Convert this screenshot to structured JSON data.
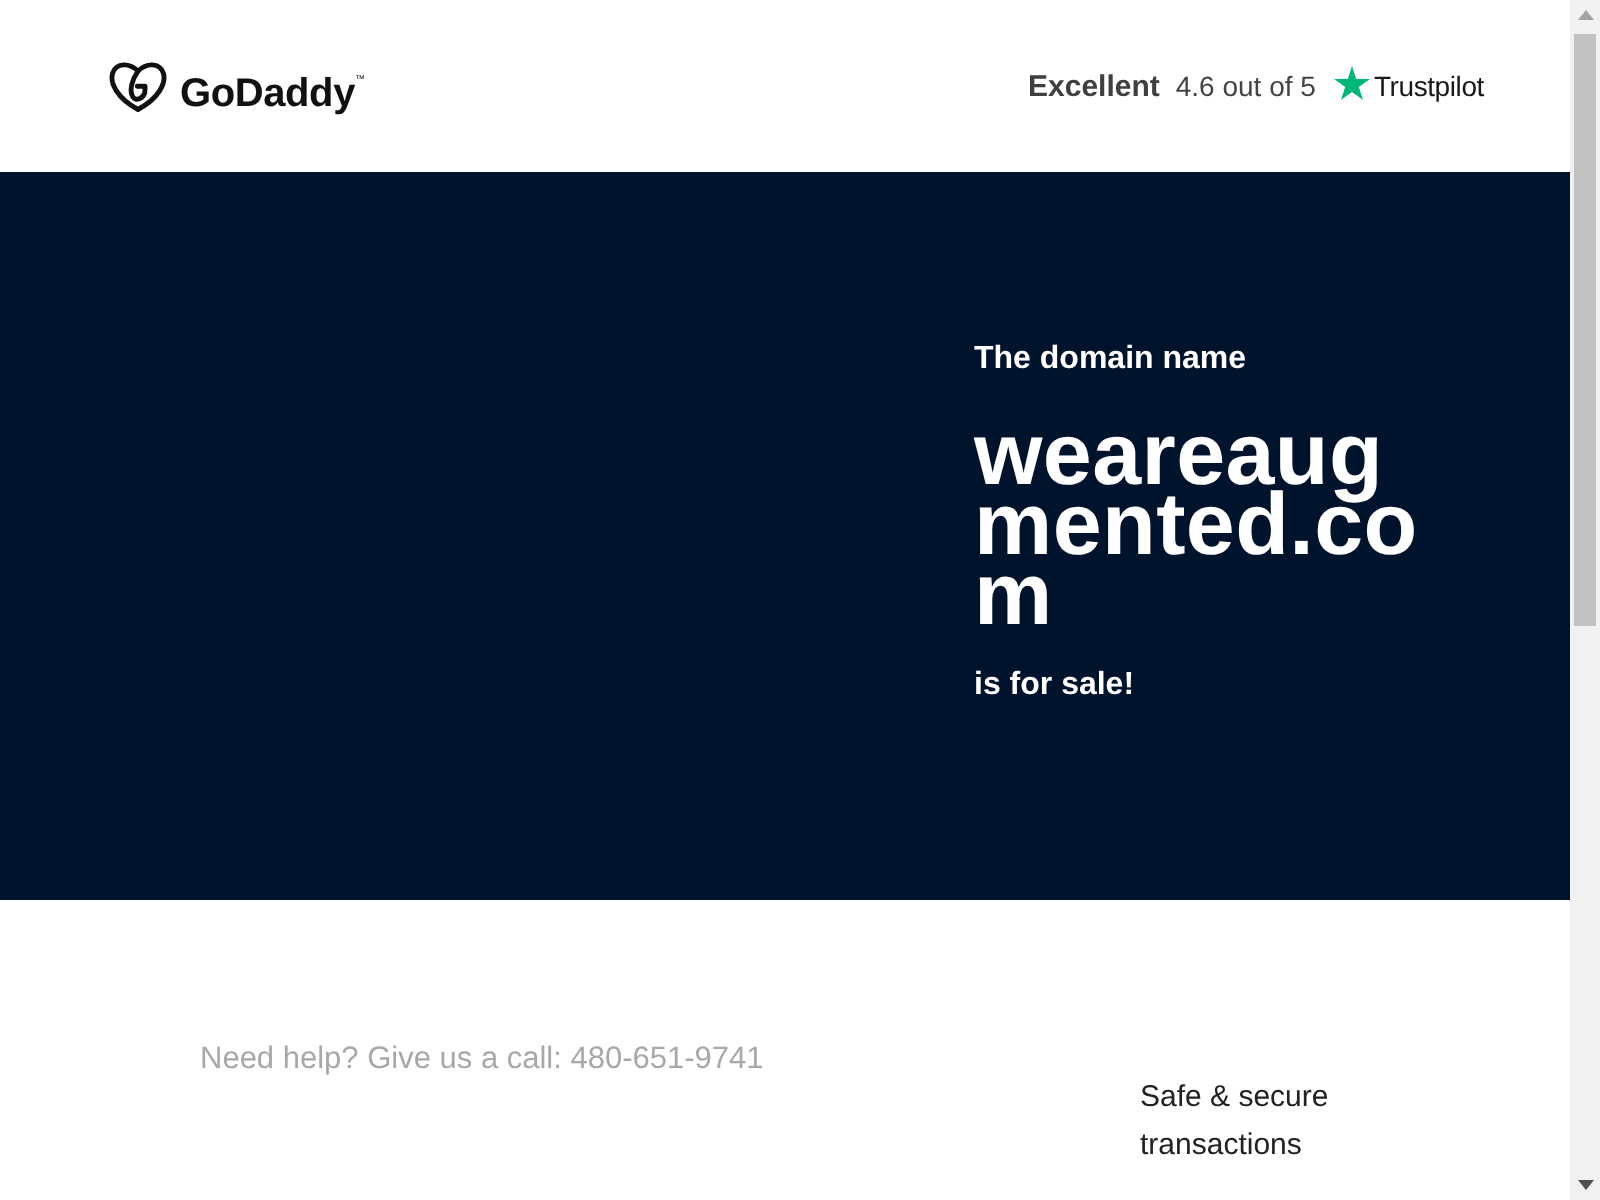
{
  "header": {
    "logo": {
      "wordmark": "GoDaddy$^{™}$"
    },
    "rating": {
      "label": "Excellent",
      "score": "4.6 out of 5",
      "brand": "Trustpilot"
    }
  },
  "hero": {
    "intro": "The domain name",
    "domain": "weareaugmented.com",
    "outro": "is for sale!"
  },
  "details": {
    "help": "Need help? Give us a call: 480-651-9741",
    "assurance": "Safe & secure transactions"
  }
}
